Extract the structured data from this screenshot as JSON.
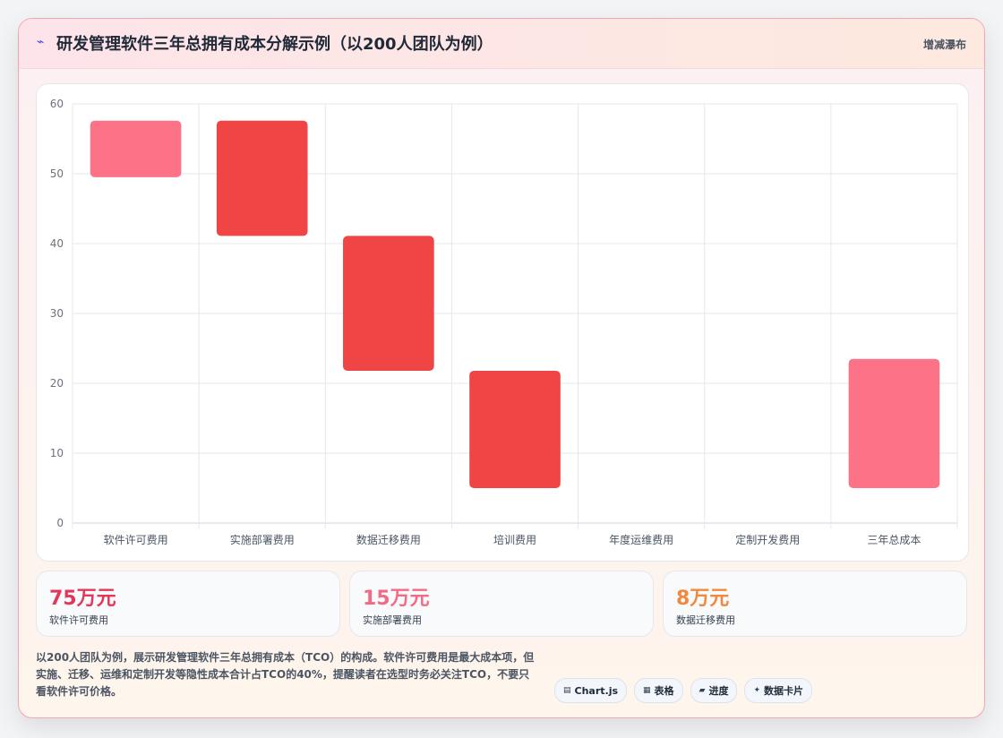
{
  "header": {
    "icon": "lightning-icon",
    "title": "研发管理软件三年总拥有成本分解示例（以200人团队为例）",
    "chart_type_label": "增减瀑布"
  },
  "chart_data": {
    "type": "bar",
    "subtype": "waterfall",
    "title": "研发管理软件三年总拥有成本分解示例（以200人团队为例）",
    "categories": [
      "软件许可费用",
      "实施部署费用",
      "数据迁移费用",
      "培训费用",
      "年度运维费用",
      "定制开发费用",
      "三年总成本"
    ],
    "ranges": [
      [
        49.5,
        57.6
      ],
      [
        41.1,
        57.6
      ],
      [
        21.8,
        41.1
      ],
      [
        5,
        21.8
      ],
      null,
      null,
      [
        5,
        23.5
      ]
    ],
    "bar_colors": [
      "#fc7388",
      "#ef4545",
      "#ef4545",
      "#ef4545",
      "#ef4545",
      "#ef4545",
      "#fc7388"
    ],
    "ylim": [
      0,
      60
    ],
    "yticks": [
      0,
      10,
      20,
      30,
      40,
      50,
      60
    ],
    "grid": true,
    "legend": "none",
    "xlabel": "",
    "ylabel": ""
  },
  "stats": [
    {
      "value": "75万元",
      "label": "软件许可费用",
      "color": "#e1385a"
    },
    {
      "value": "15万元",
      "label": "实施部署费用",
      "color": "#f26b84"
    },
    {
      "value": "8万元",
      "label": "数据迁移费用",
      "color": "#f0893e"
    }
  ],
  "summary": "以200人团队为例，展示研发管理软件三年总拥有成本（TCO）的构成。软件许可费用是最大成本项，但实施、迁移、运维和定制开发等隐性成本合计占TCO的40%，提醒读者在选型时务必关注TCO，不要只看软件许可价格。",
  "tech_tags": [
    {
      "icon": "chart-icon",
      "glyph": "▤",
      "label": "Chart.js"
    },
    {
      "icon": "table-icon",
      "glyph": "▦",
      "label": "表格"
    },
    {
      "icon": "progress-icon",
      "glyph": "▰",
      "label": "进度"
    },
    {
      "icon": "card-icon",
      "glyph": "✦",
      "label": "数据卡片"
    }
  ]
}
